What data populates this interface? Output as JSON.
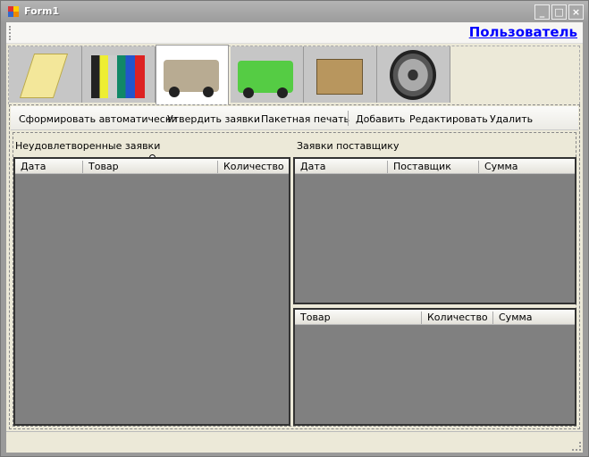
{
  "window": {
    "title": "Form1",
    "controls": [
      "_",
      "□",
      "×"
    ]
  },
  "top": {
    "user_link": "Пользователь"
  },
  "tabs": [
    {
      "icon": "notepad-icon"
    },
    {
      "icon": "binders-icon"
    },
    {
      "icon": "truck-beige-icon",
      "selected": true
    },
    {
      "icon": "truck-green-icon"
    },
    {
      "icon": "box-icon"
    },
    {
      "icon": "gear-icon"
    }
  ],
  "toolbar": {
    "auto": "Сформировать автоматически",
    "approve": "Утвердить заявки",
    "print": "Пакетная печать",
    "add": "Добавить",
    "edit": "Редактировать",
    "delete": "Удалить"
  },
  "left": {
    "label": "Неудовлетворенные заявки",
    "columns": [
      "Дата",
      "Товар",
      "Количество"
    ]
  },
  "right": {
    "label": "Заявки поставщику",
    "top_columns": [
      "Дата",
      "Поставщик",
      "Сумма"
    ],
    "bottom_columns": [
      "Товар",
      "Количество",
      "Сумма"
    ]
  },
  "colors": {
    "accent": "#0000ff",
    "grid_bg": "#808080"
  }
}
